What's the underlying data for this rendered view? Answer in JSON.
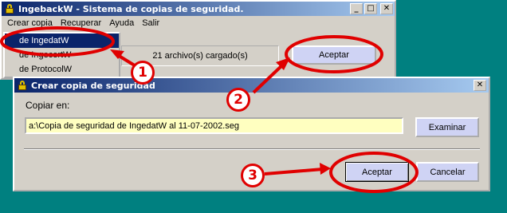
{
  "main_window": {
    "title": "IngebackW - Sistema de copias de seguridad.",
    "menu": [
      "Crear copia",
      "Recuperar",
      "Ayuda",
      "Salir"
    ],
    "dropdown_items": [
      "de IngedatW",
      "de IngecertW",
      "de ProtocolW"
    ],
    "status_text": "21 archivo(s) cargado(s)",
    "accept_label": "Aceptar",
    "minimize_glyph": "_",
    "maximize_glyph": "□",
    "close_glyph": "✕"
  },
  "dialog": {
    "title": "Crear copia de seguridad",
    "copy_label": "Copiar en:",
    "path_value": "a:\\Copia de seguridad de IngedatW al 11-07-2002.seg",
    "browse_label": "Examinar",
    "accept_label": "Aceptar",
    "cancel_label": "Cancelar",
    "close_glyph": "✕"
  },
  "annotations": {
    "step_numbers": [
      "1",
      "2",
      "3"
    ],
    "color": "#e00000"
  }
}
